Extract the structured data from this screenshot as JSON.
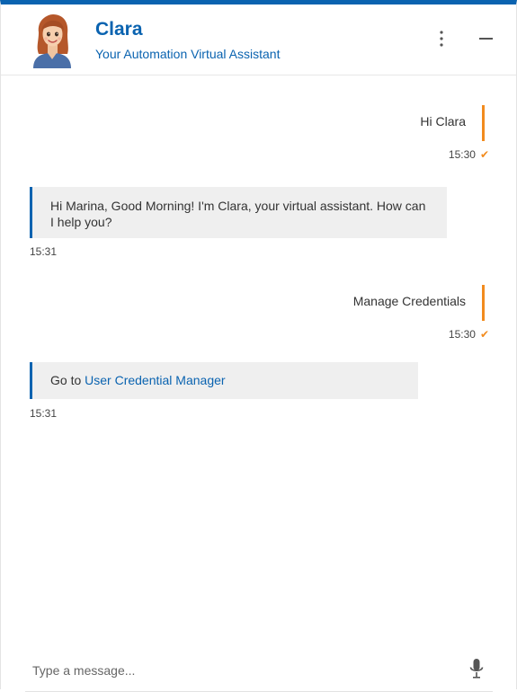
{
  "header": {
    "bot_name": "Clara",
    "subtitle": "Your Automation Virtual Assistant",
    "avatar_icon": "female-assistant-avatar",
    "menu_icon": "kebab-menu-icon",
    "minimize_icon": "minimize-icon"
  },
  "messages": [
    {
      "sender": "user",
      "text": "Hi Clara",
      "time": "15:30",
      "status_icon": "check-icon"
    },
    {
      "sender": "bot",
      "text": "Hi Marina, Good Morning! I'm Clara, your virtual assistant. How can I help you?",
      "time": "15:31"
    },
    {
      "sender": "user",
      "text": "Manage Credentials",
      "time": "15:30",
      "status_icon": "check-icon"
    },
    {
      "sender": "bot",
      "text_prefix": "Go to ",
      "link_text": "User Credential Manager",
      "time": "15:31"
    }
  ],
  "composer": {
    "placeholder": "Type a message...",
    "value": "",
    "mic_icon": "microphone-icon"
  },
  "colors": {
    "accent_blue": "#0a63b0",
    "user_accent_orange": "#f28b1e",
    "bot_bubble_bg": "#efefef"
  }
}
